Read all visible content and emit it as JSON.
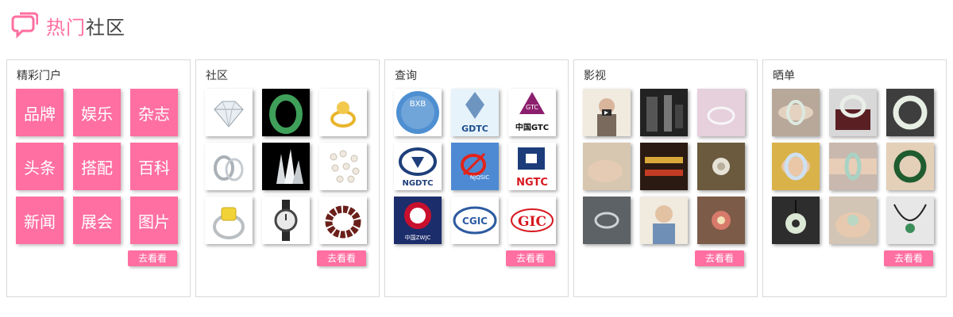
{
  "header": {
    "title_accent": "热门",
    "title_rest": "社区"
  },
  "panels": [
    {
      "title": "精彩门户",
      "categories": [
        "品牌",
        "娱乐",
        "杂志",
        "头条",
        "搭配",
        "百科",
        "新闻",
        "展会",
        "图片"
      ],
      "button": "去看看"
    },
    {
      "title": "社区",
      "button": "去看看"
    },
    {
      "title": "查询",
      "logos": {
        "bxb": "BXB",
        "gdtc": "GDTC",
        "gtc_badge": "GTC",
        "china_gtc": "中国GTC",
        "ngdtc": "NGDTC",
        "njqsic": "NJQSIC",
        "ngtc": "NGTC",
        "zwjc": "中国ZWJC",
        "cgic": "CGIC",
        "gic": "GIC"
      },
      "button": "去看看"
    },
    {
      "title": "影视",
      "button": "去看看"
    },
    {
      "title": "晒单",
      "button": "去看看"
    }
  ]
}
